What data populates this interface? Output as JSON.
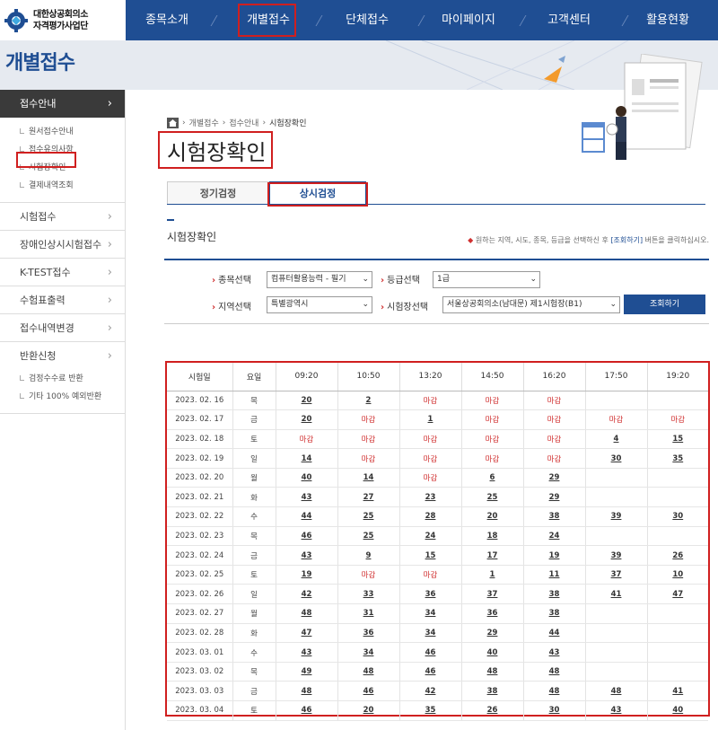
{
  "logo": {
    "line1": "대한상공회의소",
    "line2": "자격평가사업단"
  },
  "nav": [
    "종목소개",
    "개별접수",
    "단체접수",
    "마이페이지",
    "고객센터",
    "활용현황"
  ],
  "banner": {
    "title": "개별접수"
  },
  "sidebar": {
    "groups": [
      {
        "label": "접수안내",
        "subs": [
          "원서접수안내",
          "접수유의사항",
          "시험장확인",
          "결제내역조회"
        ]
      },
      {
        "label": "시험접수",
        "subs": []
      },
      {
        "label": "장애인상시시험접수",
        "subs": []
      },
      {
        "label": "K-TEST접수",
        "subs": []
      },
      {
        "label": "수험표출력",
        "subs": []
      },
      {
        "label": "접수내역변경",
        "subs": []
      },
      {
        "label": "반환신청",
        "subs": [
          "검정수수료 반환",
          "기타 100% 예외반환"
        ]
      }
    ]
  },
  "breadcrumb": [
    "개별접수",
    "접수안내",
    "시험장확인"
  ],
  "page_title": "시험장확인",
  "tabs": [
    "정기검정",
    "상시검정"
  ],
  "section_title": "시험장확인",
  "notice": {
    "pre": "원하는 지역, 시도, 종목, 등급을 선택하신 후",
    "link": "[조회하기]",
    "post": "버튼을 클릭하십시오."
  },
  "filters": {
    "subject_label": "종목선택",
    "subject_value": "컴퓨터활용능력 - 필기",
    "grade_label": "등급선택",
    "grade_value": "1급",
    "region_label": "지역선택",
    "region_value": "특별광역시",
    "site_label": "시험장선택",
    "site_value": "서울상공회의소(남대문) 제1시험장(B1)",
    "search_button": "조회하기"
  },
  "table": {
    "headers": [
      "시험일",
      "요일",
      "09:20",
      "10:50",
      "13:20",
      "14:50",
      "16:20",
      "17:50",
      "19:20"
    ],
    "rows": [
      [
        "2023. 02. 16",
        "목",
        "20",
        "2",
        "마감",
        "마감",
        "마감",
        "",
        ""
      ],
      [
        "2023. 02. 17",
        "금",
        "20",
        "마감",
        "1",
        "마감",
        "마감",
        "마감",
        "마감"
      ],
      [
        "2023. 02. 18",
        "토",
        "마감",
        "마감",
        "마감",
        "마감",
        "마감",
        "4",
        "15"
      ],
      [
        "2023. 02. 19",
        "일",
        "14",
        "마감",
        "마감",
        "마감",
        "마감",
        "30",
        "35"
      ],
      [
        "2023. 02. 20",
        "월",
        "40",
        "14",
        "마감",
        "6",
        "29",
        "",
        ""
      ],
      [
        "2023. 02. 21",
        "화",
        "43",
        "27",
        "23",
        "25",
        "29",
        "",
        ""
      ],
      [
        "2023. 02. 22",
        "수",
        "44",
        "25",
        "28",
        "20",
        "38",
        "39",
        "30"
      ],
      [
        "2023. 02. 23",
        "목",
        "46",
        "25",
        "24",
        "18",
        "24",
        "",
        ""
      ],
      [
        "2023. 02. 24",
        "금",
        "43",
        "9",
        "15",
        "17",
        "19",
        "39",
        "26"
      ],
      [
        "2023. 02. 25",
        "토",
        "19",
        "마감",
        "마감",
        "1",
        "11",
        "37",
        "10"
      ],
      [
        "2023. 02. 26",
        "일",
        "42",
        "33",
        "36",
        "37",
        "38",
        "41",
        "47"
      ],
      [
        "2023. 02. 27",
        "월",
        "48",
        "31",
        "34",
        "36",
        "38",
        "",
        ""
      ],
      [
        "2023. 02. 28",
        "화",
        "47",
        "36",
        "34",
        "29",
        "44",
        "",
        ""
      ],
      [
        "2023. 03. 01",
        "수",
        "43",
        "34",
        "46",
        "40",
        "43",
        "",
        ""
      ],
      [
        "2023. 03. 02",
        "목",
        "49",
        "48",
        "46",
        "48",
        "48",
        "",
        ""
      ],
      [
        "2023. 03. 03",
        "금",
        "48",
        "46",
        "42",
        "38",
        "48",
        "48",
        "41"
      ],
      [
        "2023. 03. 04",
        "토",
        "46",
        "20",
        "35",
        "26",
        "30",
        "43",
        "40"
      ]
    ]
  },
  "colors": {
    "navy": "#1f4e93",
    "red_highlight": "#d01f1f",
    "closed_text": "#d03030"
  }
}
